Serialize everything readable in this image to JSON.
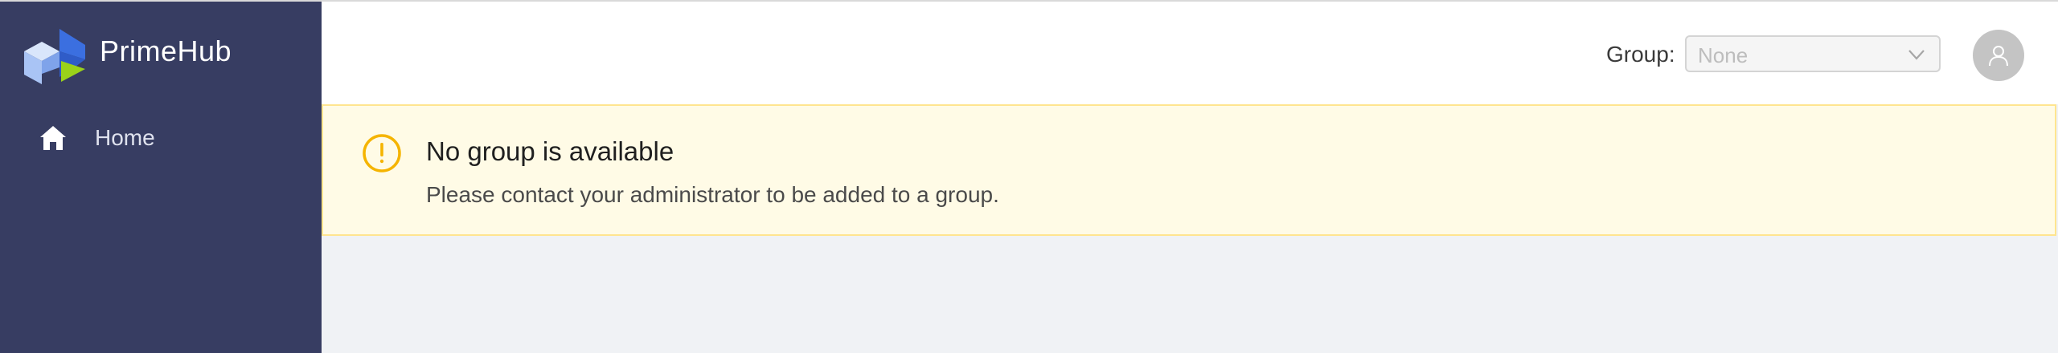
{
  "app": {
    "name": "PrimeHub",
    "logo_icon": "primehub-cube-logo-icon"
  },
  "sidebar": {
    "items": [
      {
        "label": "Home",
        "icon": "home-icon"
      }
    ]
  },
  "header": {
    "group_label": "Group:",
    "group_select": {
      "value": "None",
      "disabled": true,
      "icon": "chevron-down-icon"
    },
    "avatar_icon": "user-icon"
  },
  "alert": {
    "type": "warning",
    "icon": "exclamation-circle-icon",
    "title": "No group is available",
    "description": "Please contact your administrator to be added to a group."
  },
  "colors": {
    "sidebar_bg": "#373d62",
    "page_bg": "#f0f2f5",
    "alert_bg": "#fffbe6",
    "alert_border": "#ffe58f",
    "warning": "#f5b400",
    "logo_blue": "#3b6fe0",
    "logo_light_blue": "#a9c4f5",
    "logo_green": "#9ad21a"
  }
}
